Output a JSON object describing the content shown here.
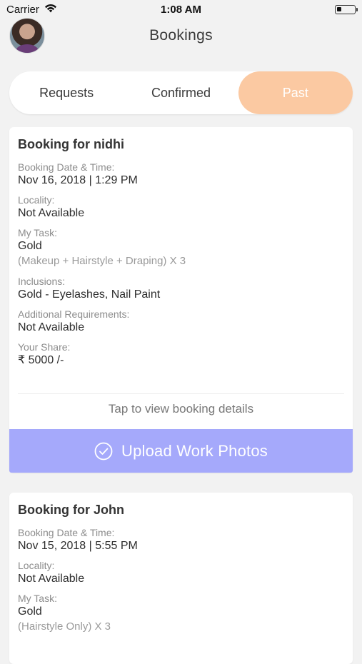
{
  "status_bar": {
    "carrier": "Carrier",
    "time": "1:08 AM"
  },
  "header": {
    "title": "Bookings"
  },
  "tabs": [
    {
      "label": "Requests",
      "active": false
    },
    {
      "label": "Confirmed",
      "active": false
    },
    {
      "label": "Past",
      "active": true
    }
  ],
  "colors": {
    "active_tab": "#fbc9a2",
    "upload_button": "#a5a9fb",
    "background": "#f2f2f2"
  },
  "bookings": [
    {
      "title": "Booking for nidhi",
      "date_label": "Booking Date & Time:",
      "date_value": "Nov 16, 2018 | 1:29 PM",
      "locality_label": "Locality:",
      "locality_value": "Not Available",
      "task_label": "My Task:",
      "task_value": "Gold",
      "task_detail": "(Makeup + Hairstyle + Draping) X 3",
      "inclusions_label": "Inclusions:",
      "inclusions_value": "Gold - Eyelashes, Nail Paint",
      "additional_label": "Additional Requirements:",
      "additional_value": "Not Available",
      "share_label": "Your Share:",
      "share_value": "₹ 5000 /-",
      "tap_text": "Tap to view booking details",
      "upload_label": "Upload Work Photos"
    },
    {
      "title": "Booking for John",
      "date_label": "Booking Date & Time:",
      "date_value": "Nov 15, 2018 | 5:55 PM",
      "locality_label": "Locality:",
      "locality_value": "Not Available",
      "task_label": "My Task:",
      "task_value": "Gold",
      "task_detail": "(Hairstyle Only) X 3"
    }
  ]
}
